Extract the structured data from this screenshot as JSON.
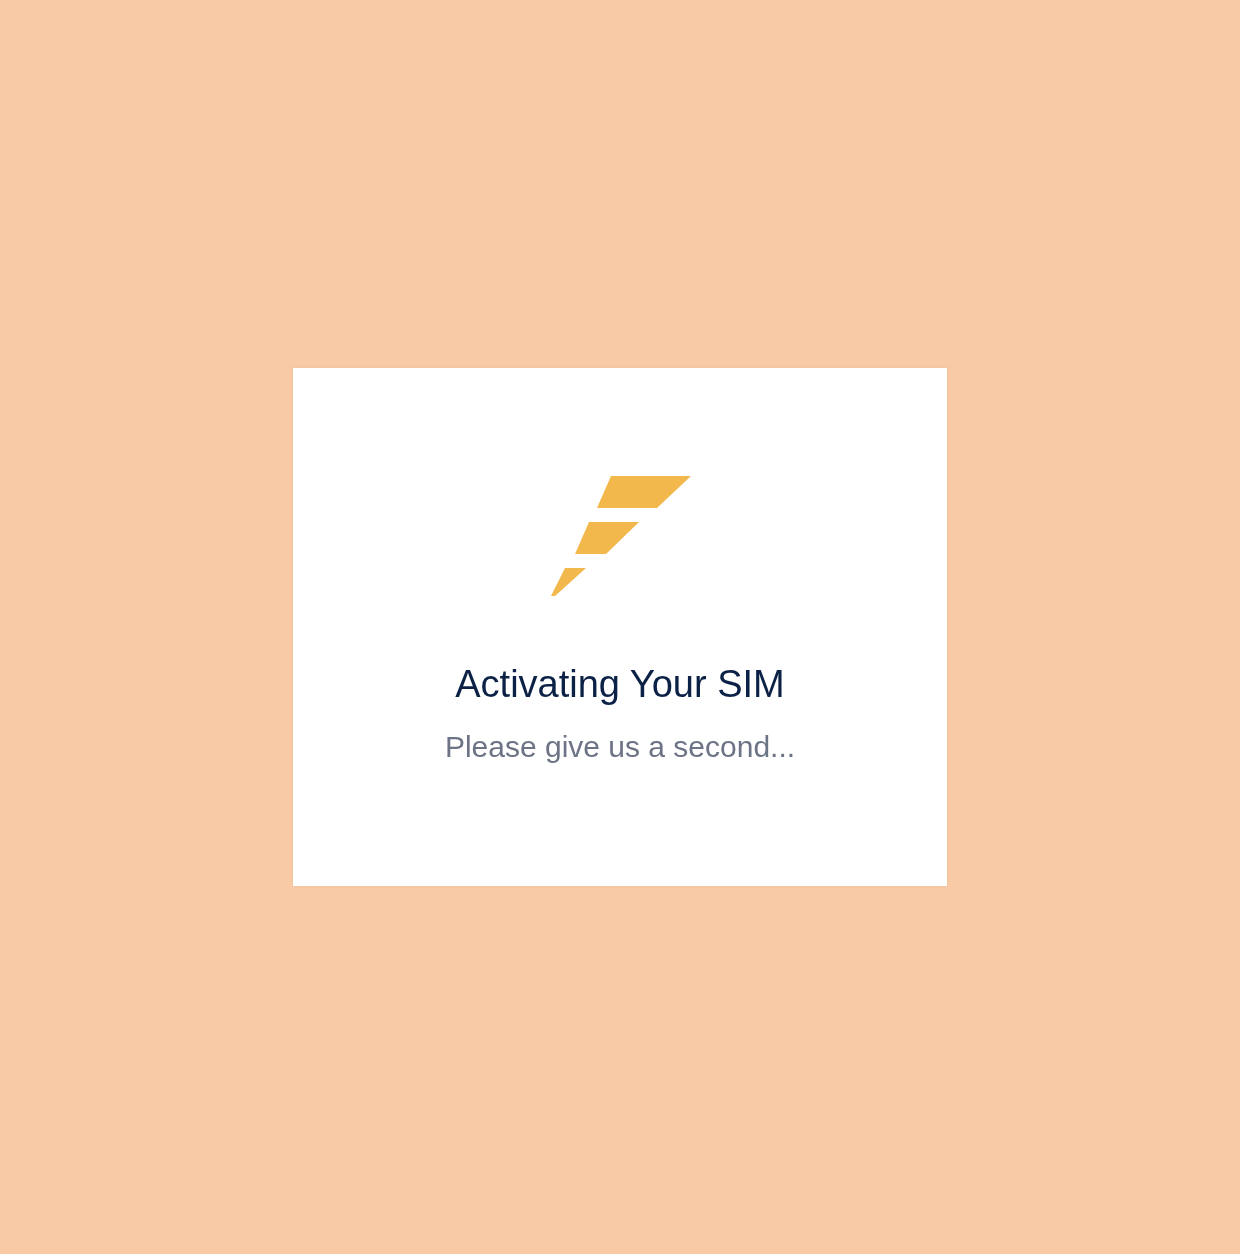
{
  "dialog": {
    "title": "Activating Your SIM",
    "message": "Please give us a second..."
  }
}
